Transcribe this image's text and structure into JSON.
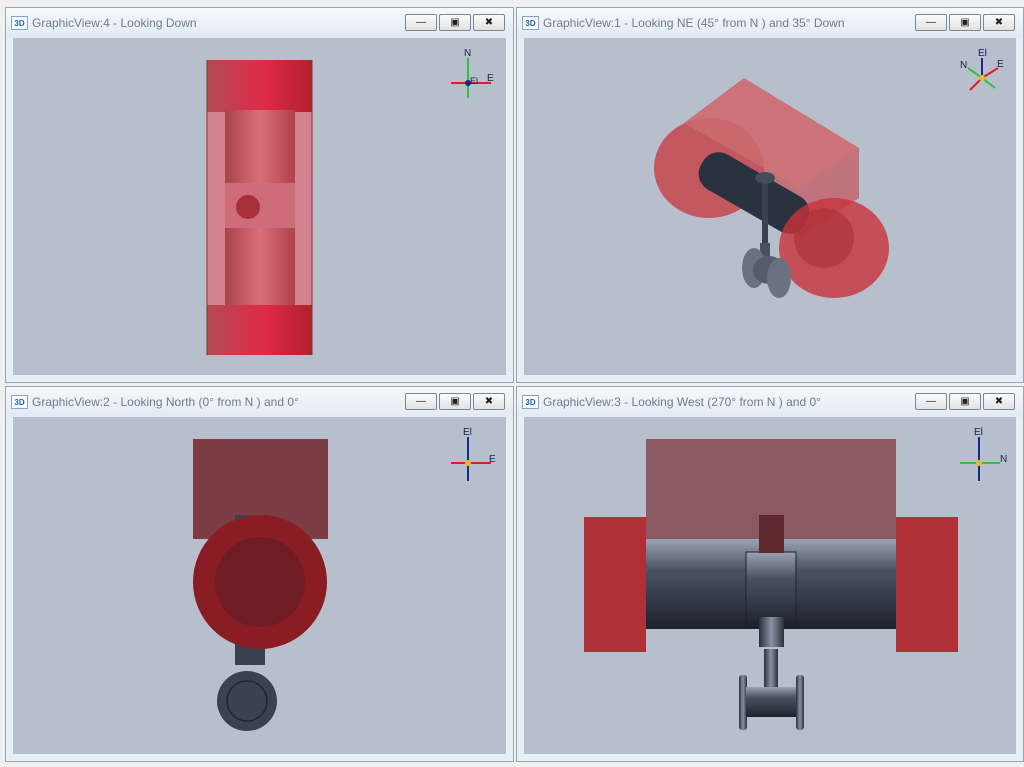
{
  "app_icon_text": "3D",
  "controls": {
    "minimize": "—",
    "restore": "▣",
    "close": "✖"
  },
  "panes": [
    {
      "title": "GraphicView:4 - Looking Down",
      "compass": {
        "up": "N",
        "right": "E",
        "center": "El"
      }
    },
    {
      "title": "GraphicView:1 - Looking NE (45° from N ) and 35° Down",
      "compass": {
        "up": "El",
        "right": "E",
        "left": "N"
      }
    },
    {
      "title": "GraphicView:2 - Looking North (0° from N ) and 0°",
      "compass": {
        "up": "El",
        "right": "E"
      }
    },
    {
      "title": "GraphicView:3 - Looking West (270° from N ) and 0°",
      "compass": {
        "up": "El",
        "right": "N"
      }
    }
  ],
  "colors": {
    "viewport_bg": "#b8bfcc",
    "flange_red": "#c2272d",
    "pipe_steel": "#3a4250"
  }
}
